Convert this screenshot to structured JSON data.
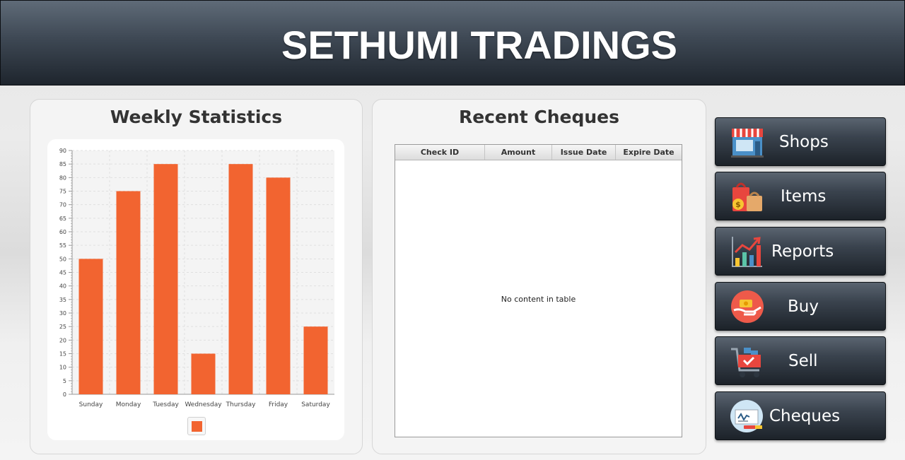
{
  "header": {
    "title": "SETHUMI TRADINGS"
  },
  "stats_panel": {
    "title": "Weekly Statistics"
  },
  "chart_data": {
    "type": "bar",
    "categories": [
      "Sunday",
      "Monday",
      "Tuesday",
      "Wednesday",
      "Thursday",
      "Friday",
      "Saturday"
    ],
    "values": [
      50,
      75,
      85,
      15,
      85,
      80,
      25
    ],
    "ylim": [
      0,
      90
    ],
    "yticks": [
      0,
      5,
      10,
      15,
      20,
      25,
      30,
      35,
      40,
      45,
      50,
      55,
      60,
      65,
      70,
      75,
      80,
      85,
      90
    ],
    "grid": true,
    "legend": "bottom",
    "bar_color": "#f26430",
    "title": "",
    "xlabel": "",
    "ylabel": ""
  },
  "cheques_panel": {
    "title": "Recent Cheques",
    "columns": [
      "Check ID",
      "Amount",
      "Issue Date",
      "Expire Date"
    ],
    "empty_message": "No content in table"
  },
  "nav": [
    {
      "label": "Shops",
      "icon": "shop-icon"
    },
    {
      "label": "Items",
      "icon": "shopping-bags-icon"
    },
    {
      "label": "Reports",
      "icon": "bar-chart-icon"
    },
    {
      "label": "Buy",
      "icon": "money-hand-icon"
    },
    {
      "label": "Sell",
      "icon": "shopping-cart-icon"
    },
    {
      "label": "Cheques",
      "icon": "cheque-icon"
    }
  ]
}
